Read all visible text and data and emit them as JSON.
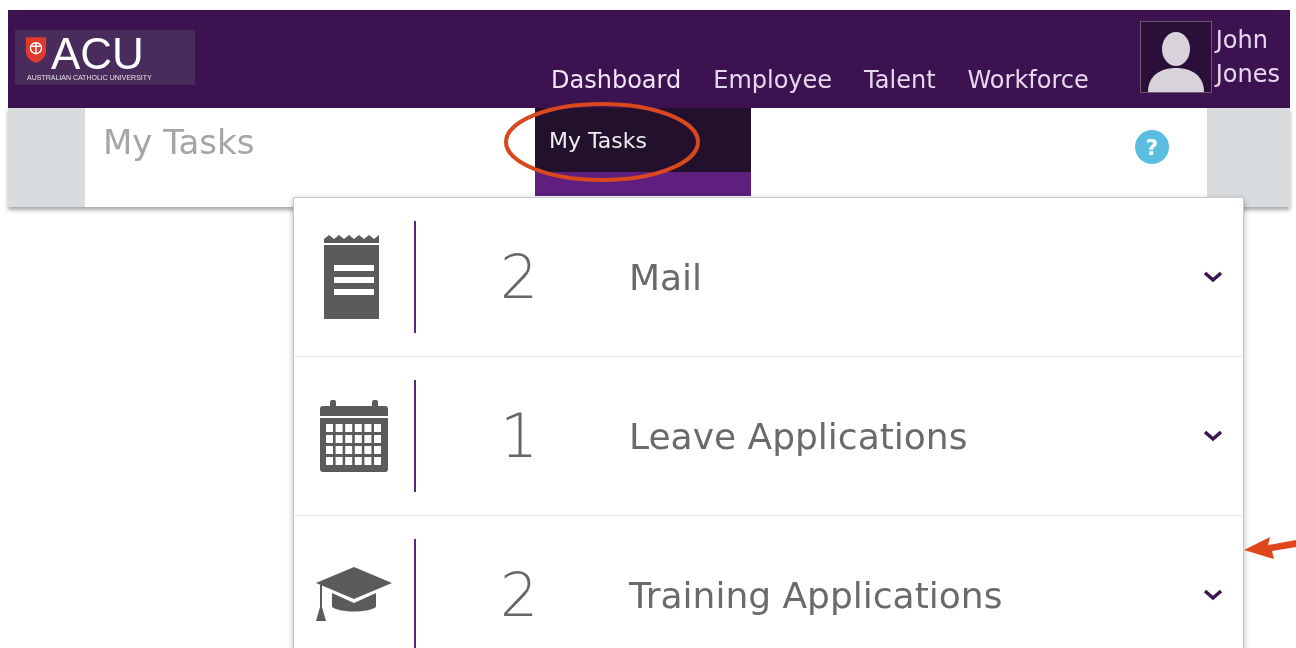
{
  "header": {
    "logo": {
      "wordmark": "ACU",
      "tagline": "AUSTRALIAN CATHOLIC UNIVERSITY"
    },
    "nav": [
      {
        "label": "Dashboard",
        "expanded": true,
        "menu": [
          {
            "label": "My Tasks",
            "selected": true
          }
        ]
      },
      {
        "label": "Employee",
        "expanded": false
      },
      {
        "label": "Talent",
        "expanded": false
      },
      {
        "label": "Workforce",
        "expanded": false
      }
    ],
    "user": {
      "first_name": "John",
      "last_name": "Jones"
    }
  },
  "page": {
    "title": "My Tasks",
    "help": "?"
  },
  "tasks": [
    {
      "kind": "mail",
      "count": "2",
      "label": "Mail",
      "expanded": false
    },
    {
      "kind": "leave",
      "count": "1",
      "label": "Leave Applications",
      "expanded": false
    },
    {
      "kind": "training",
      "count": "2",
      "label": "Training Applications",
      "expanded": false
    }
  ]
}
